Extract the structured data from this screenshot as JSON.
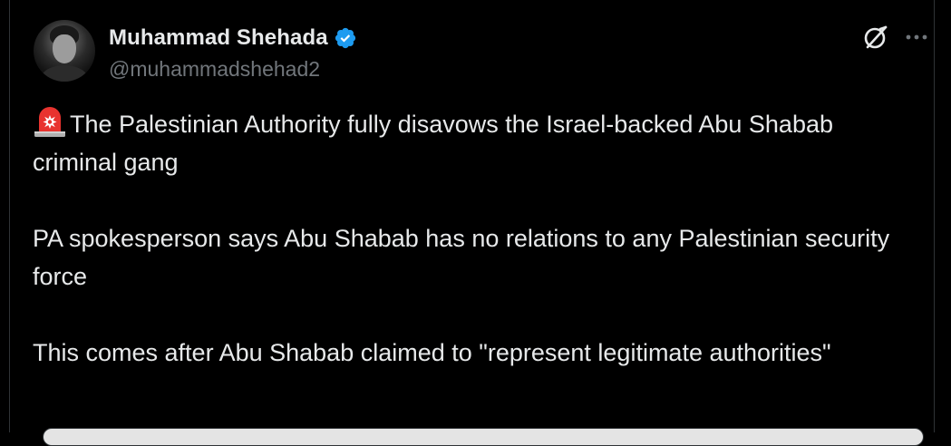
{
  "author": {
    "display_name": "Muhammad Shehada",
    "handle": "@muhammadshehad2",
    "verified": true,
    "verified_color": "#1d9bf0"
  },
  "icons": {
    "avatar": "profile-photo",
    "verified": "verified-badge-icon",
    "grok": "grok-icon",
    "more": "more-options-icon",
    "siren": "rotating-light-emoji"
  },
  "tweet": {
    "paragraphs": [
      "The Palestinian Authority fully disavows the Israel-backed Abu Shabab criminal gang",
      "PA spokesperson says Abu Shabab has no relations to any Palestinian security force",
      "This comes after Abu Shabab claimed to \"represent legitimate authorities\""
    ]
  },
  "colors": {
    "background": "#000000",
    "text": "#e7e9ea",
    "secondary_text": "#71767b",
    "accent": "#1d9bf0"
  }
}
